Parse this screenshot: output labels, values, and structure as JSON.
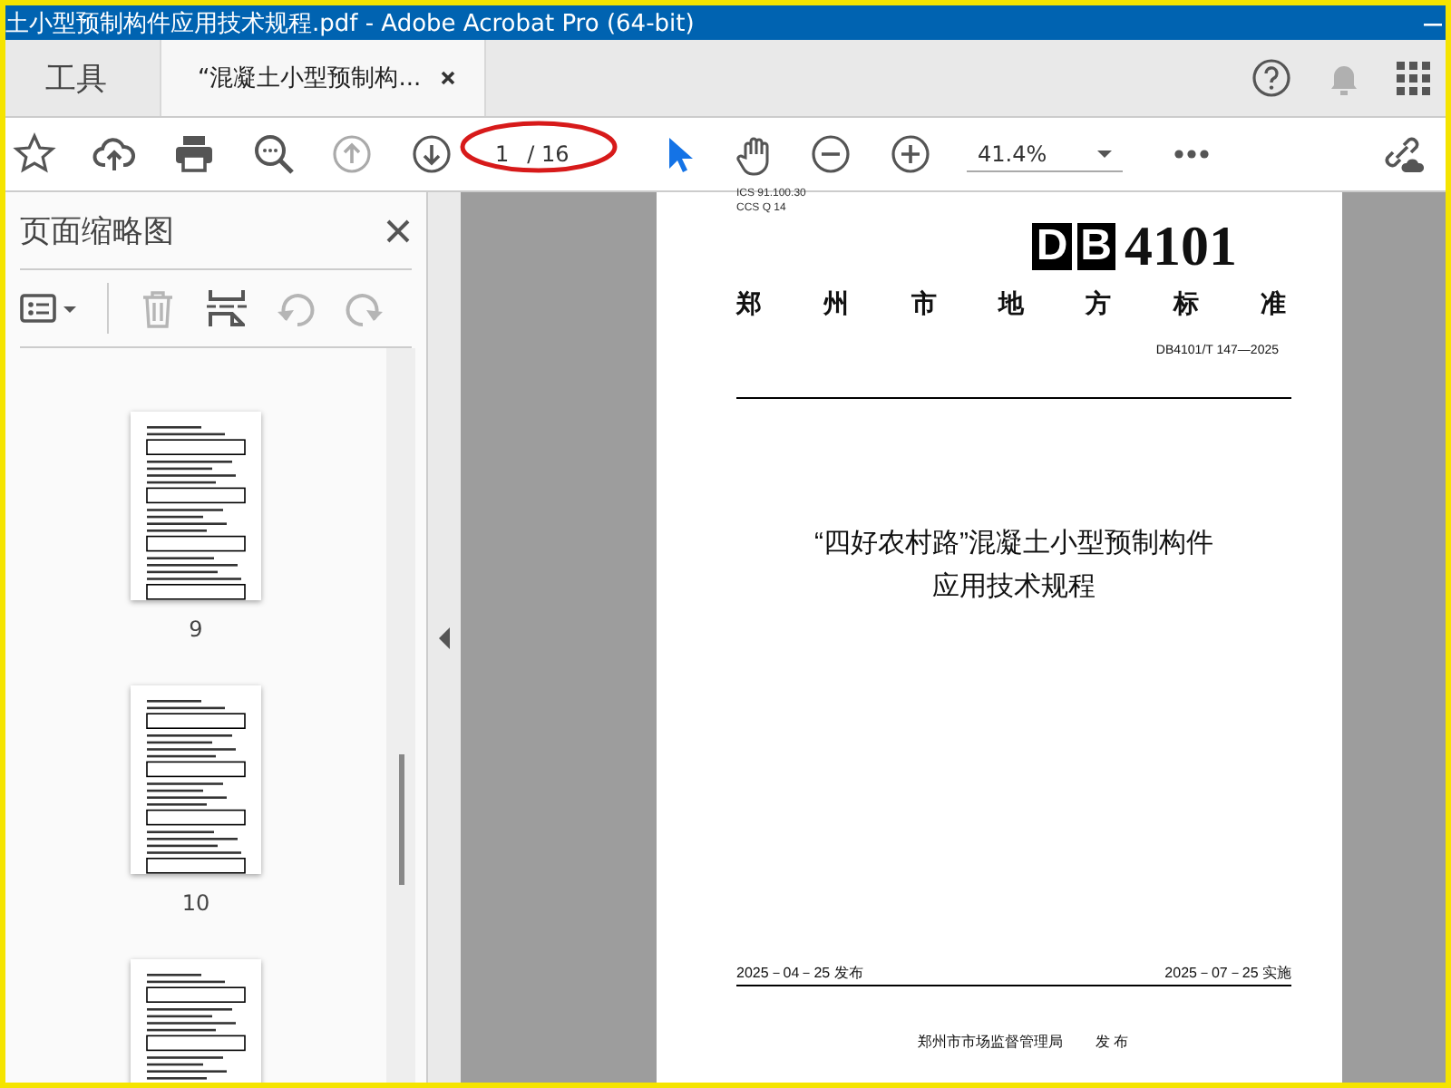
{
  "window": {
    "title": "土小型预制构件应用技术规程.pdf - Adobe Acrobat Pro (64-bit)"
  },
  "tabs": [
    {
      "label": "工具",
      "selected": false
    },
    {
      "label": "“混凝土小型预制构...",
      "selected": true
    }
  ],
  "toolbar": {
    "page_current": "1",
    "page_total": "/ 16",
    "zoom": "41.4%"
  },
  "thumbnail_panel": {
    "title": "页面缩略图",
    "thumbnails": [
      {
        "label": "9"
      },
      {
        "label": "10"
      }
    ]
  },
  "document_page": {
    "ics": "ICS 91.100.30",
    "ccs": "CCS Q 14",
    "logo_letters": [
      "D",
      "B"
    ],
    "code": "4101",
    "authority_chars": [
      "郑",
      "州",
      "市",
      "地",
      "方",
      "标",
      "准"
    ],
    "number": "DB4101/T 147—2025",
    "title_lines": [
      "“四好农村路”混凝土小型预制构件",
      "应用技术规程"
    ],
    "issue_date": "2025－04－25 发布",
    "effective_date": "2025－07－25 实施",
    "issuer": "郑州市市场监督管理局",
    "issue_word": "发 布"
  }
}
